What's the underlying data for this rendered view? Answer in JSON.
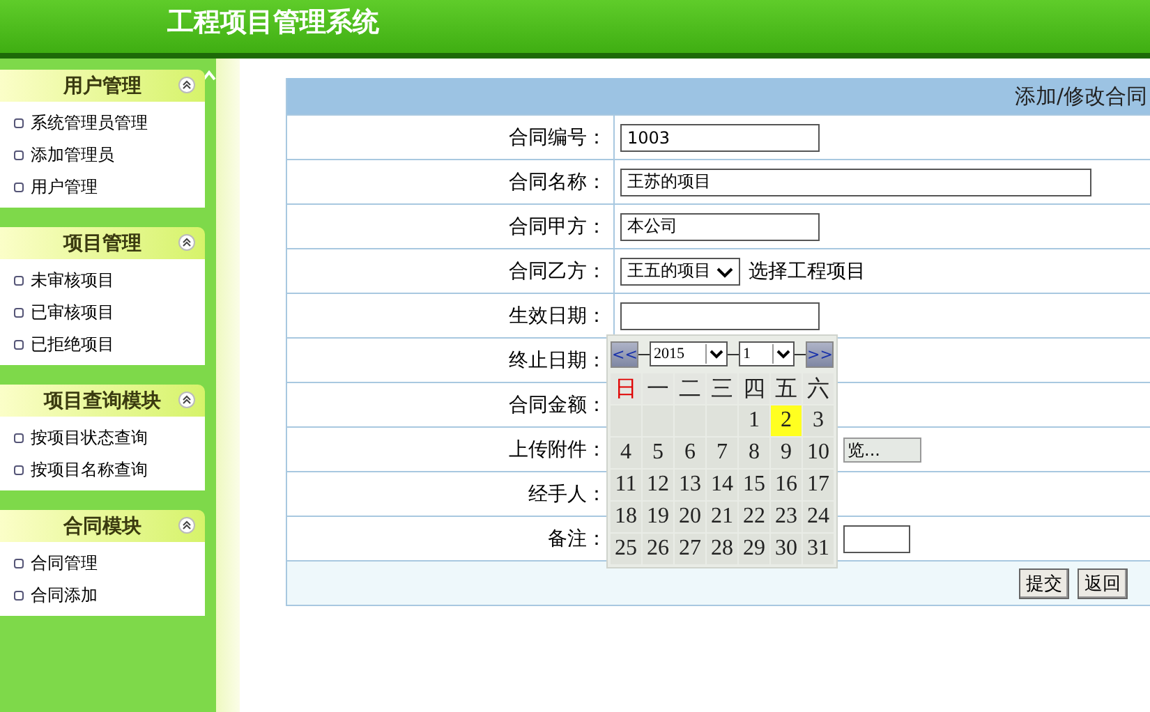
{
  "header": {
    "title": "工程项目管理系统"
  },
  "sidebar": {
    "sections": [
      {
        "title": "用户管理",
        "expanded": true,
        "items": [
          "系统管理员管理",
          "添加管理员",
          "用户管理"
        ]
      },
      {
        "title": "项目管理",
        "expanded": true,
        "items": [
          "未审核项目",
          "已审核项目",
          "已拒绝项目"
        ]
      },
      {
        "title": "项目查询模块",
        "expanded": true,
        "items": [
          "按项目状态查询",
          "按项目名称查询"
        ]
      },
      {
        "title": "合同模块",
        "expanded": true,
        "items": [
          "合同管理",
          "合同添加"
        ]
      }
    ]
  },
  "form": {
    "heading": "添加/修改合同",
    "rows": [
      {
        "label": "合同编号：",
        "kind": "text",
        "value": "1003"
      },
      {
        "label": "合同名称：",
        "kind": "long-text",
        "value": "王苏的项目"
      },
      {
        "label": "合同甲方：",
        "kind": "text",
        "value": "本公司"
      },
      {
        "label": "合同乙方：",
        "kind": "select",
        "value": "王五的项目",
        "note": "选择工程项目"
      },
      {
        "label": "生效日期：",
        "kind": "text",
        "value": ""
      },
      {
        "label": "终止日期：",
        "kind": "hidden"
      },
      {
        "label": "合同金额：",
        "kind": "hidden"
      },
      {
        "label": "上传附件：",
        "kind": "file",
        "button": "览..."
      },
      {
        "label": "经手人：",
        "kind": "hidden"
      },
      {
        "label": "备注：",
        "kind": "partial"
      }
    ],
    "buttons": [
      "提交",
      "返回"
    ]
  },
  "datepicker": {
    "prev": "<<",
    "next": ">>",
    "year": "2015",
    "month": "1",
    "weekdays": [
      {
        "label": "日",
        "weekend": true
      },
      {
        "label": "一",
        "weekend": false
      },
      {
        "label": "二",
        "weekend": false
      },
      {
        "label": "三",
        "weekend": false
      },
      {
        "label": "四",
        "weekend": false
      },
      {
        "label": "五",
        "weekend": false
      },
      {
        "label": "六",
        "weekend": false
      }
    ],
    "days": [
      {
        "day": "1",
        "selected": false
      },
      {
        "day": "2",
        "selected": true
      },
      {
        "day": "3",
        "selected": false
      },
      {
        "day": "4",
        "selected": false
      },
      {
        "day": "5",
        "selected": false
      },
      {
        "day": "6",
        "selected": false
      },
      {
        "day": "7",
        "selected": false
      },
      {
        "day": "8",
        "selected": false
      },
      {
        "day": "9",
        "selected": false
      },
      {
        "day": "10",
        "selected": false
      },
      {
        "day": "11",
        "selected": false
      },
      {
        "day": "12",
        "selected": false
      },
      {
        "day": "13",
        "selected": false
      },
      {
        "day": "14",
        "selected": false
      },
      {
        "day": "15",
        "selected": false
      },
      {
        "day": "16",
        "selected": false
      },
      {
        "day": "17",
        "selected": false
      },
      {
        "day": "18",
        "selected": false
      },
      {
        "day": "19",
        "selected": false
      },
      {
        "day": "20",
        "selected": false
      },
      {
        "day": "21",
        "selected": false
      },
      {
        "day": "22",
        "selected": false
      },
      {
        "day": "23",
        "selected": false
      },
      {
        "day": "24",
        "selected": false
      },
      {
        "day": "25",
        "selected": false
      },
      {
        "day": "26",
        "selected": false
      },
      {
        "day": "27",
        "selected": false
      },
      {
        "day": "28",
        "selected": false
      },
      {
        "day": "29",
        "selected": false
      },
      {
        "day": "30",
        "selected": false
      },
      {
        "day": "31",
        "selected": false
      }
    ]
  }
}
